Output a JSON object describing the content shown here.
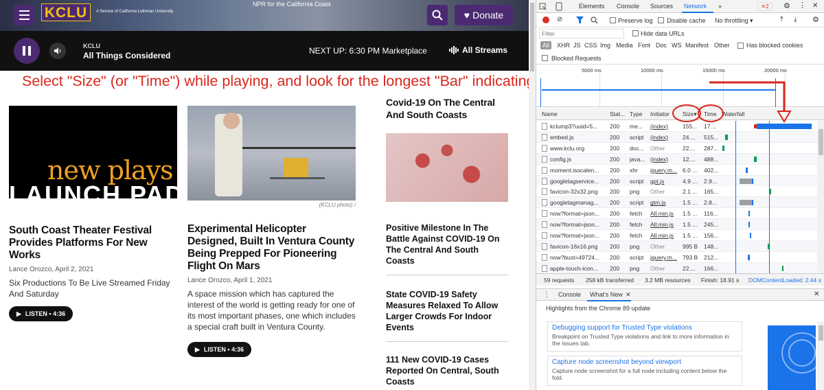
{
  "site": {
    "logo": "KCLU",
    "logo_sub": "A Service of California Lutheran University",
    "tagline": "NPR for the California Coast",
    "donate_label": "Donate",
    "player": {
      "station": "KCLU",
      "show": "All Things Considered",
      "next_up": "NEXT UP: 6:30 PM Marketplace",
      "all_streams": "All Streams"
    },
    "annotation": "Select \"Size\" (or \"Time\") while playing, and look for the longest \"Bar\" indicating activity.",
    "articles": [
      {
        "image_text_1": "new plays",
        "image_text_2": "LAUNCH PAD",
        "title": "South Coast Theater Festival Provides Platforms For New Works",
        "byline": "Lance Orozco, April 2, 2021",
        "teaser": "Six Productions To Be Live Streamed Friday And Saturday",
        "listen": "LISTEN • 4:36"
      },
      {
        "credit": "(KCLU photo) /",
        "title": "Experimental Helicopter Designed, Built In Ventura County Being Prepped For Pioneering Flight On Mars",
        "byline": "Lance Orozco, April 1, 2021",
        "teaser": "A space mission which has captured the interest of the world is getting ready for one of its most important phases, one which includes a special craft built in Ventura County.",
        "listen": "LISTEN • 4:36"
      }
    ],
    "sidebar": [
      "Covid-19 On The Central And South Coasts",
      "Positive Milestone In The Battle Against COVID-19 On The Central And South Coasts",
      "State COVID-19 Safety Measures Relaxed To Allow Larger Crowds For Indoor Events",
      "111 New COVID-19 Cases Reported On Central, South Coasts"
    ]
  },
  "devtools": {
    "tabs": [
      "Elements",
      "Console",
      "Sources",
      "Network"
    ],
    "active_tab": "Network",
    "error_count": "2",
    "preserve_log": "Preserve log",
    "disable_cache": "Disable cache",
    "throttling": "No throttling",
    "filter_placeholder": "Filter",
    "hide_data_urls": "Hide data URLs",
    "type_filters": [
      "All",
      "XHR",
      "JS",
      "CSS",
      "Img",
      "Media",
      "Font",
      "Doc",
      "WS",
      "Manifest",
      "Other"
    ],
    "has_blocked_cookies": "Has blocked cookies",
    "blocked_requests": "Blocked Requests",
    "timeline_ticks": [
      "5000 ms",
      "10000 ms",
      "15000 ms",
      "20000 ms"
    ],
    "columns": [
      "Name",
      "Stat...",
      "Type",
      "Initiator",
      "Size",
      "Time",
      "Waterfall"
    ],
    "rows": [
      {
        "name": "kclump3?uuid=5...",
        "status": "200",
        "type": "me...",
        "initiator": "(index)",
        "size": "155...",
        "time": "17....",
        "init_link": true
      },
      {
        "name": "embed.js",
        "status": "200",
        "type": "script",
        "initiator": "(index)",
        "size": "24....",
        "time": "515...",
        "init_link": true
      },
      {
        "name": "www.kclu.org",
        "status": "200",
        "type": "doc...",
        "initiator": "Other",
        "size": "22....",
        "time": "287...",
        "init_link": false
      },
      {
        "name": "config.js",
        "status": "200",
        "type": "java...",
        "initiator": "(index)",
        "size": "12....",
        "time": "488...",
        "init_link": true
      },
      {
        "name": "moment.isocalen...",
        "status": "200",
        "type": "xhr",
        "initiator": "jquery.m...",
        "size": "6.0 ...",
        "time": "402...",
        "init_link": true
      },
      {
        "name": "googletagservice...",
        "status": "200",
        "type": "script",
        "initiator": "gpt.js",
        "size": "4.9 ...",
        "time": "2.9...",
        "init_link": true
      },
      {
        "name": "favicon-32x32.png",
        "status": "200",
        "type": "png",
        "initiator": "Other",
        "size": "2.1 ...",
        "time": "165...",
        "init_link": false
      },
      {
        "name": "googletagmanag...",
        "status": "200",
        "type": "script",
        "initiator": "gtm.js",
        "size": "1.5 ...",
        "time": "2.8...",
        "init_link": true
      },
      {
        "name": "now?format=json...",
        "status": "200",
        "type": "fetch",
        "initiator": "All.min.js",
        "size": "1.5 ...",
        "time": "116...",
        "init_link": true
      },
      {
        "name": "now?format=json...",
        "status": "200",
        "type": "fetch",
        "initiator": "All.min.js",
        "size": "1.5 ...",
        "time": "245...",
        "init_link": true
      },
      {
        "name": "now?format=json...",
        "status": "200",
        "type": "fetch",
        "initiator": "All.min.js",
        "size": "1.5 ...",
        "time": "156...",
        "init_link": true
      },
      {
        "name": "favicon-16x16.png",
        "status": "200",
        "type": "png",
        "initiator": "Other",
        "size": "995 B",
        "time": "148...",
        "init_link": false
      },
      {
        "name": "now?bust=49724...",
        "status": "200",
        "type": "script",
        "initiator": "jquery.m...",
        "size": "793 B",
        "time": "212...",
        "init_link": true
      },
      {
        "name": "apple-touch-icon...",
        "status": "200",
        "type": "png",
        "initiator": "Other",
        "size": "22....",
        "time": "166...",
        "init_link": false
      }
    ],
    "status_bar": {
      "requests": "59 requests",
      "transferred": "258 kB transferred",
      "resources": "3.2 MB resources",
      "finish": "Finish: 18.91 s",
      "dcl": "DOMContentLoaded: 2.44 s"
    },
    "drawer_tabs": [
      "Console",
      "What's New"
    ],
    "highlights": "Highlights from the Chrome 89 update",
    "news": [
      {
        "title": "Debugging support for Trusted Type violations",
        "desc": "Breakpoint on Trusted Type violations and link to more information in the Issues tab."
      },
      {
        "title": "Capture node screenshot beyond viewport",
        "desc": "Capture node screenshot for a full node including content below the fold."
      }
    ]
  }
}
